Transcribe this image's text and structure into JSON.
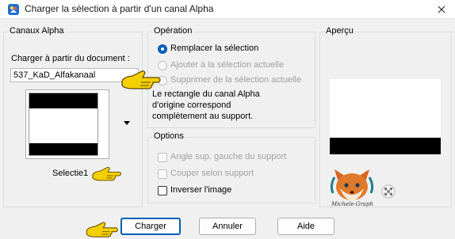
{
  "window": {
    "title": "Charger la sélection à partir d'un canal Alpha"
  },
  "alpha_channels": {
    "title": "Canaux Alpha",
    "load_from_label": "Charger à partir du document :",
    "document_value": "537_KaD_Alfakanaal",
    "channel_name": "Selectie1"
  },
  "operation": {
    "title": "Opération",
    "options": [
      {
        "label": "Remplacer la sélection",
        "checked": true,
        "enabled": true
      },
      {
        "label": "Ajouter à la sélection actuelle",
        "checked": false,
        "enabled": false
      },
      {
        "label": "Supprimer de la sélection actuelle",
        "checked": false,
        "enabled": false
      }
    ],
    "info_lines": [
      "Le rectangle du canal Alpha",
      "d'origine correspond",
      "complètement au support."
    ]
  },
  "options": {
    "title": "Options",
    "items": [
      {
        "label": "Angle sup. gauche du support",
        "checked": false,
        "enabled": false
      },
      {
        "label": "Couper selon support",
        "checked": false,
        "enabled": false
      },
      {
        "label": "Inverser l'image",
        "checked": false,
        "enabled": true
      }
    ]
  },
  "preview": {
    "title": "Aperçu"
  },
  "watermark": {
    "text": "Michele-Graph"
  },
  "buttons": {
    "load": "Charger",
    "cancel": "Annuler",
    "help": "Aide"
  },
  "colors": {
    "accent": "#005fb8",
    "pointer_hand": "#f5d000",
    "disabled_text": "#a0a0a0"
  }
}
